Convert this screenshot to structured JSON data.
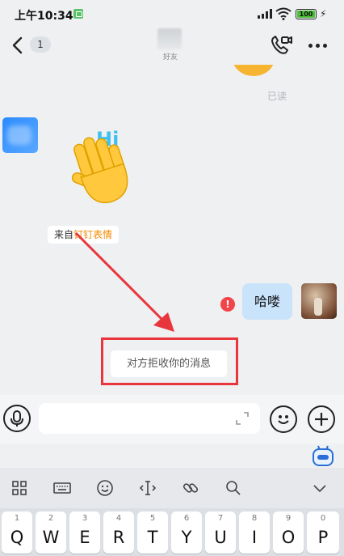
{
  "status_bar": {
    "time": "上午10:34",
    "battery": "100"
  },
  "header": {
    "unread_count": "1",
    "contact_subtitle": "好友"
  },
  "chat": {
    "read_status": "已读",
    "sticker_text": "Hi",
    "source_prefix": "来自",
    "source_link": "钉钉表情",
    "sent_message": "哈喽",
    "error_mark": "!",
    "system_message": "对方拒收你的消息"
  },
  "input": {
    "value": "",
    "placeholder": ""
  },
  "keyboard": {
    "keys": [
      {
        "num": "1",
        "letter": "Q"
      },
      {
        "num": "2",
        "letter": "W"
      },
      {
        "num": "3",
        "letter": "E"
      },
      {
        "num": "4",
        "letter": "R"
      },
      {
        "num": "5",
        "letter": "T"
      },
      {
        "num": "6",
        "letter": "Y"
      },
      {
        "num": "7",
        "letter": "U"
      },
      {
        "num": "8",
        "letter": "I"
      },
      {
        "num": "9",
        "letter": "O"
      },
      {
        "num": "0",
        "letter": "P"
      }
    ]
  },
  "colors": {
    "accent_link": "#f28a00",
    "error_red": "#f2454a",
    "sent_bubble": "#c9e3fb",
    "annotation_red": "#e8363c"
  },
  "icons": [
    "back-arrow-icon",
    "video-call-icon",
    "more-icon",
    "mic-icon",
    "expand-icon",
    "emoji-icon",
    "plus-icon",
    "robot-icon",
    "grid-icon",
    "keyboard-icon",
    "emoji-icon",
    "cursor-icon",
    "link-icon",
    "search-icon",
    "chevron-down-icon"
  ]
}
